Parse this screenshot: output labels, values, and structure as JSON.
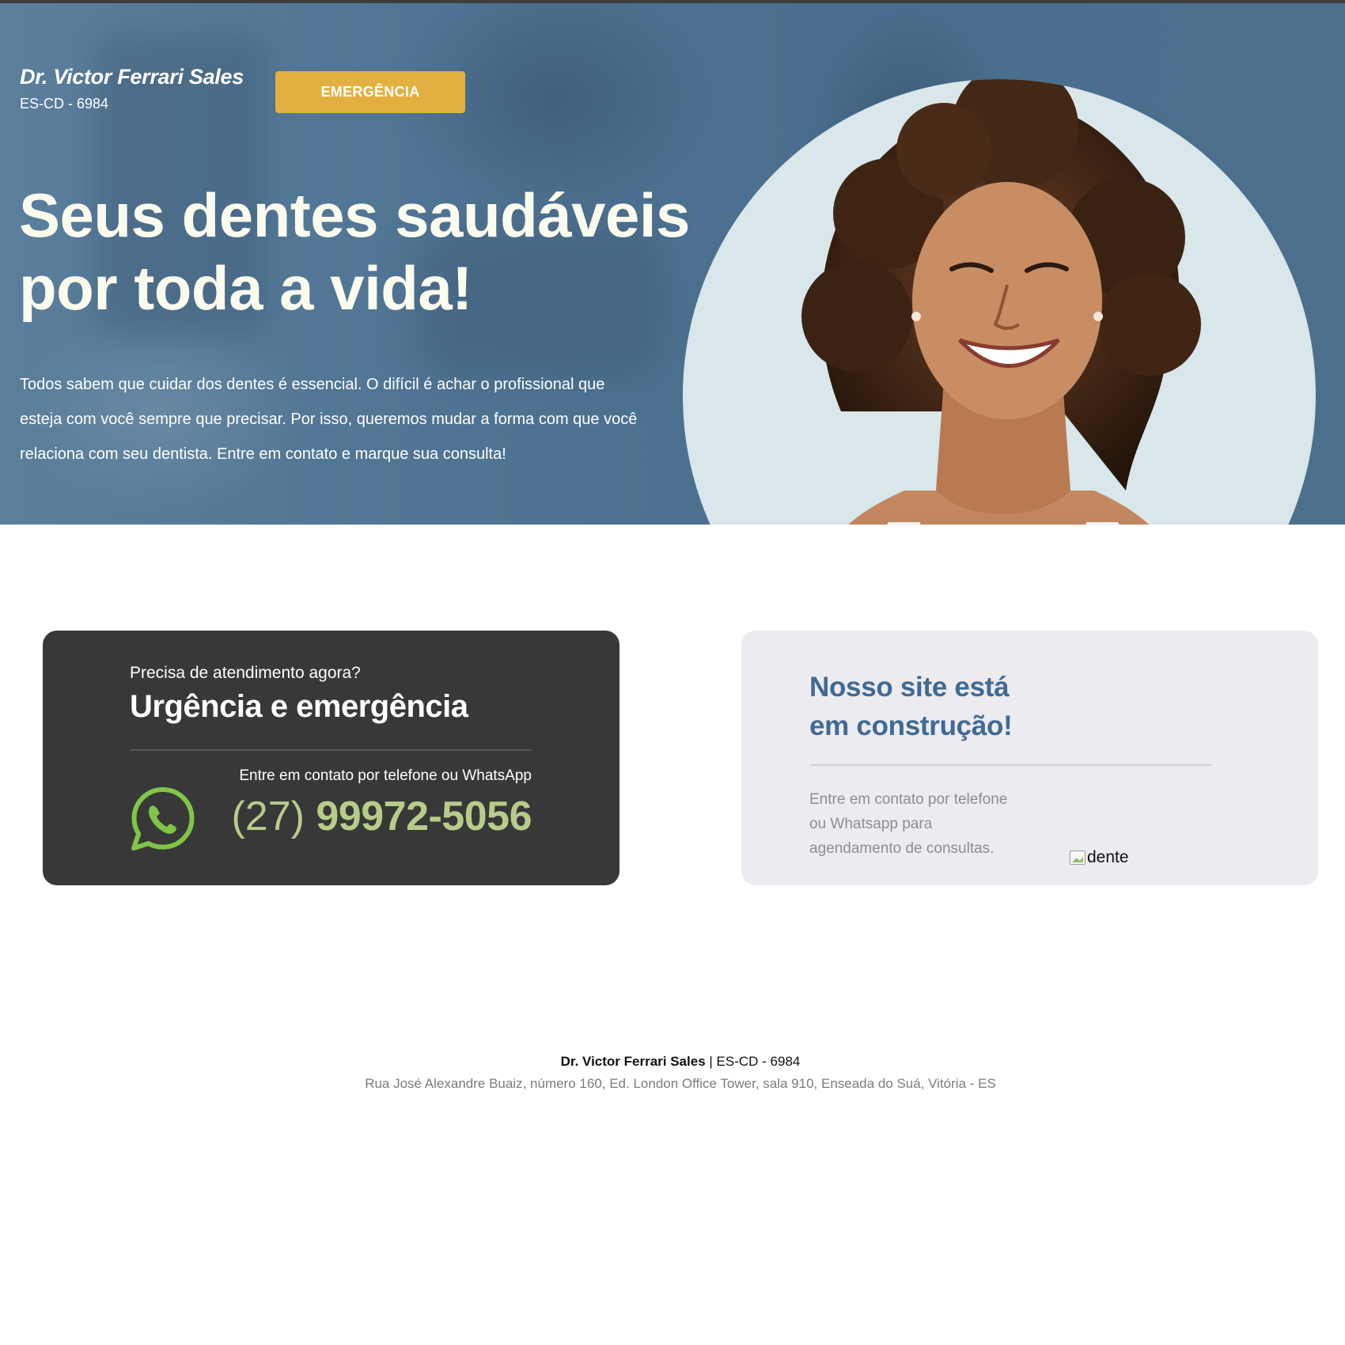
{
  "header": {
    "brand_name": "Dr. Victor Ferrari Sales",
    "brand_registration": "ES-CD - 6984",
    "emergency_button": "EMERGÊNCIA"
  },
  "hero": {
    "title_line1": "Seus dentes saudáveis",
    "title_line2": "por toda a vida!",
    "description": "Todos sabem que cuidar dos dentes é essencial. O difícil é achar o profissional que esteja com você sempre que precisar. Por isso, queremos mudar a forma com que você relaciona com seu dentista. Entre em contato e marque sua consulta!"
  },
  "emergency_card": {
    "pre_title": "Precisa de atendimento agora?",
    "title": "Urgência e emergência",
    "contact_text": "Entre em contato por telefone ou WhatsApp",
    "phone_area": "(27)",
    "phone_number": "99972-5056",
    "icon": "whatsapp-icon"
  },
  "construction_card": {
    "title_line1": "Nosso site está",
    "title_line2": "em construção!",
    "text": "Entre em contato por telefone ou Whatsapp para agendamento de consultas.",
    "image_alt": "dente"
  },
  "footer": {
    "name": "Dr. Victor Ferrari Sales",
    "separator": " | ",
    "registration": "ES-CD - 6984",
    "address": "Rua José Alexandre Buaiz, número 160, Ed. London Office Tower, sala 910, Enseada do Suá, Vitória - ES"
  },
  "colors": {
    "hero_bg": "#4f7493",
    "accent_button": "#e1b040",
    "hero_title": "#fbfbee",
    "dark_card": "#383838",
    "phone_green": "#b8cc8a",
    "whatsapp_green": "#7fc548",
    "construction_title": "#3f6a94",
    "light_card": "#ecebf0"
  }
}
